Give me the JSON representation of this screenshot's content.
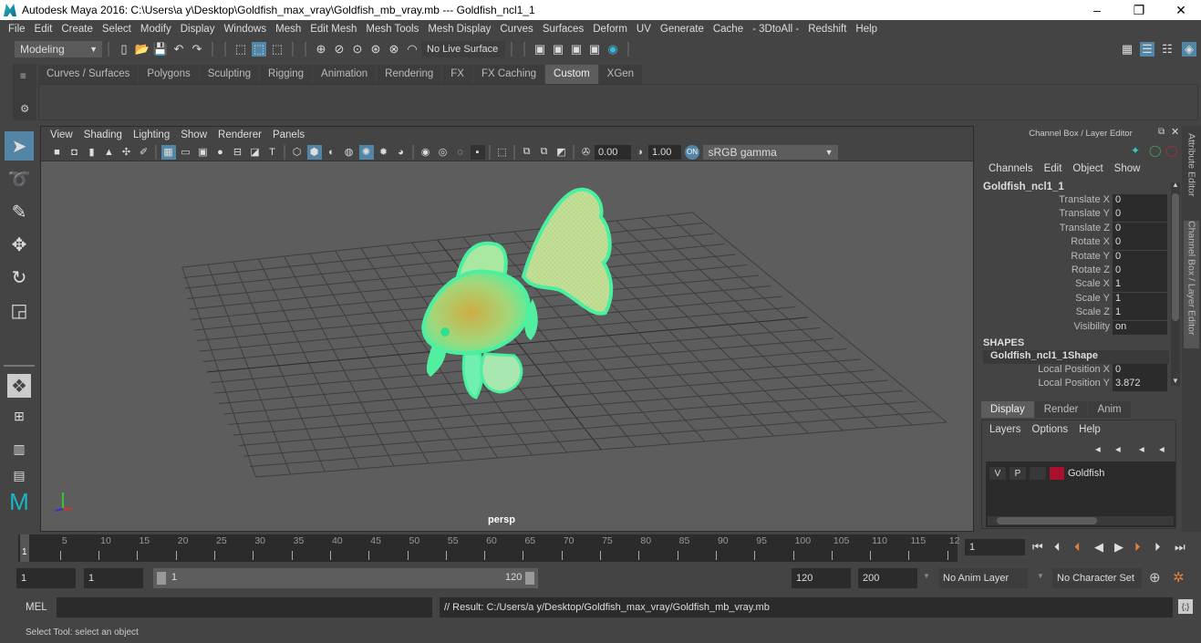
{
  "titlebar": {
    "title": "Autodesk Maya 2016: C:\\Users\\a y\\Desktop\\Goldfish_max_vray\\Goldfish_mb_vray.mb   ---   Goldfish_ncl1_1",
    "minimize": "–",
    "maximize": "❐",
    "close": "✕"
  },
  "menubar": [
    "File",
    "Edit",
    "Create",
    "Select",
    "Modify",
    "Display",
    "Windows",
    "Mesh",
    "Edit Mesh",
    "Mesh Tools",
    "Mesh Display",
    "Curves",
    "Surfaces",
    "Deform",
    "UV",
    "Generate",
    "Cache",
    "- 3DtoAll -",
    "Redshift",
    "Help"
  ],
  "statusline": {
    "mode": "Modeling",
    "live_surface": "No Live Surface"
  },
  "shelf": {
    "tabs": [
      "Curves / Surfaces",
      "Polygons",
      "Sculpting",
      "Rigging",
      "Animation",
      "Rendering",
      "FX",
      "FX Caching",
      "Custom",
      "XGen"
    ],
    "active_tab": "Custom"
  },
  "viewport": {
    "menu": [
      "View",
      "Shading",
      "Lighting",
      "Show",
      "Renderer",
      "Panels"
    ],
    "exposure": "0.00",
    "gamma": "1.00",
    "color_space": "sRGB gamma",
    "camera_label": "persp",
    "axis": {
      "y_color": "#3cc13c",
      "x_color": "#d43030",
      "z_color": "#3030d0"
    }
  },
  "channel_box": {
    "header": "Channel Box / Layer Editor",
    "menu": [
      "Channels",
      "Edit",
      "Object",
      "Show"
    ],
    "object_name": "Goldfish_ncl1_1",
    "channels": [
      {
        "label": "Translate X",
        "value": "0"
      },
      {
        "label": "Translate Y",
        "value": "0"
      },
      {
        "label": "Translate Z",
        "value": "0"
      },
      {
        "label": "Rotate X",
        "value": "0"
      },
      {
        "label": "Rotate Y",
        "value": "0"
      },
      {
        "label": "Rotate Z",
        "value": "0"
      },
      {
        "label": "Scale X",
        "value": "1"
      },
      {
        "label": "Scale Y",
        "value": "1"
      },
      {
        "label": "Scale Z",
        "value": "1"
      },
      {
        "label": "Visibility",
        "value": "on"
      }
    ],
    "shapes_header": "SHAPES",
    "shape_name": "Goldfish_ncl1_1Shape",
    "shape_channels": [
      {
        "label": "Local Position X",
        "value": "0"
      },
      {
        "label": "Local Position Y",
        "value": "3.872"
      }
    ]
  },
  "side_tabs": [
    "Attribute Editor",
    "Channel Box / Layer Editor"
  ],
  "layer_editor": {
    "tabs": [
      "Display",
      "Render",
      "Anim"
    ],
    "active_tab": "Display",
    "menu": [
      "Layers",
      "Options",
      "Help"
    ],
    "layers": [
      {
        "v": "V",
        "p": "P",
        "color": "#a8102c",
        "name": "Goldfish"
      }
    ]
  },
  "timeline": {
    "ticks": [
      5,
      10,
      15,
      20,
      25,
      30,
      35,
      40,
      45,
      50,
      55,
      60,
      65,
      70,
      75,
      80,
      85,
      90,
      95,
      100,
      105,
      110,
      115,
      "12"
    ],
    "current_frame_marker": "1",
    "current_frame": "1"
  },
  "range": {
    "start": "1",
    "playback_start": "1",
    "slider_start": "1",
    "slider_end": "120",
    "playback_end": "120",
    "end": "200",
    "anim_layer": "No Anim Layer",
    "character_set": "No Character Set"
  },
  "command_line": {
    "lang": "MEL",
    "result": "// Result: C:/Users/a y/Desktop/Goldfish_max_vray/Goldfish_mb_vray.mb"
  },
  "help_line": "Select Tool: select an object",
  "colors": {
    "accent": "#5285a6",
    "mesh": "#4af0a0",
    "layer": "#a8102c"
  }
}
